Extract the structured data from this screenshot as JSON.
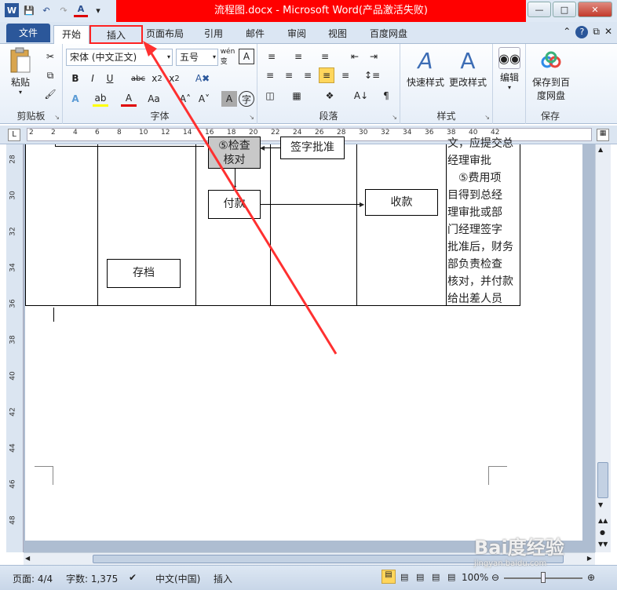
{
  "window": {
    "title": "流程图.docx - Microsoft Word(产品激活失败)"
  },
  "qat": {
    "icons": [
      "word-icon",
      "save-icon",
      "undo-icon",
      "redo-icon",
      "font-color-icon",
      "customize-icon"
    ]
  },
  "tabs": {
    "file": "文件",
    "home": "开始",
    "insert": "插入",
    "layout": "页面布局",
    "references": "引用",
    "mailings": "邮件",
    "review": "审阅",
    "view": "视图",
    "baidu": "百度网盘"
  },
  "ribbon": {
    "clipboard": {
      "label": "剪贴板",
      "paste": "粘贴"
    },
    "font": {
      "label": "字体",
      "font_name": "宋体 (中文正文)",
      "font_size": "五号"
    },
    "paragraph": {
      "label": "段落"
    },
    "styles": {
      "label": "样式",
      "quick_styles": "快速样式",
      "change_styles": "更改样式"
    },
    "editing": {
      "label": "编辑"
    },
    "save": {
      "label": "保存",
      "save_baidu": "保存到百度网盘"
    }
  },
  "ruler": {
    "h_ticks": [
      "2",
      "2",
      "4",
      "6",
      "8",
      "10",
      "12",
      "14",
      "16",
      "18",
      "20",
      "22",
      "24",
      "26",
      "28",
      "30",
      "32",
      "34",
      "36",
      "38",
      "40",
      "42"
    ],
    "v_ticks": [
      "28",
      "30",
      "32",
      "34",
      "36",
      "38",
      "40",
      "42",
      "44",
      "46",
      "48"
    ]
  },
  "document": {
    "box_check_line1": "⑤检查",
    "box_check_line2": "核对",
    "box_approve": "签字批准",
    "box_pay": "付款",
    "box_receive": "收款",
    "box_archive": "存档",
    "notes": [
      "文，应提交总",
      "经理审批",
      "　⑤费用项",
      "目得到总经",
      "理审批或部",
      "门经理签字",
      "批准后，财务",
      "部负责检查",
      "核对，并付款",
      "给出差人员"
    ]
  },
  "status": {
    "page": "页面: 4/4",
    "words": "字数: 1,375",
    "language": "中文(中国)",
    "insert": "插入",
    "zoom": "100%"
  },
  "watermark": {
    "text": "Bai度经验",
    "sub": "jingyan.baidu.com"
  }
}
